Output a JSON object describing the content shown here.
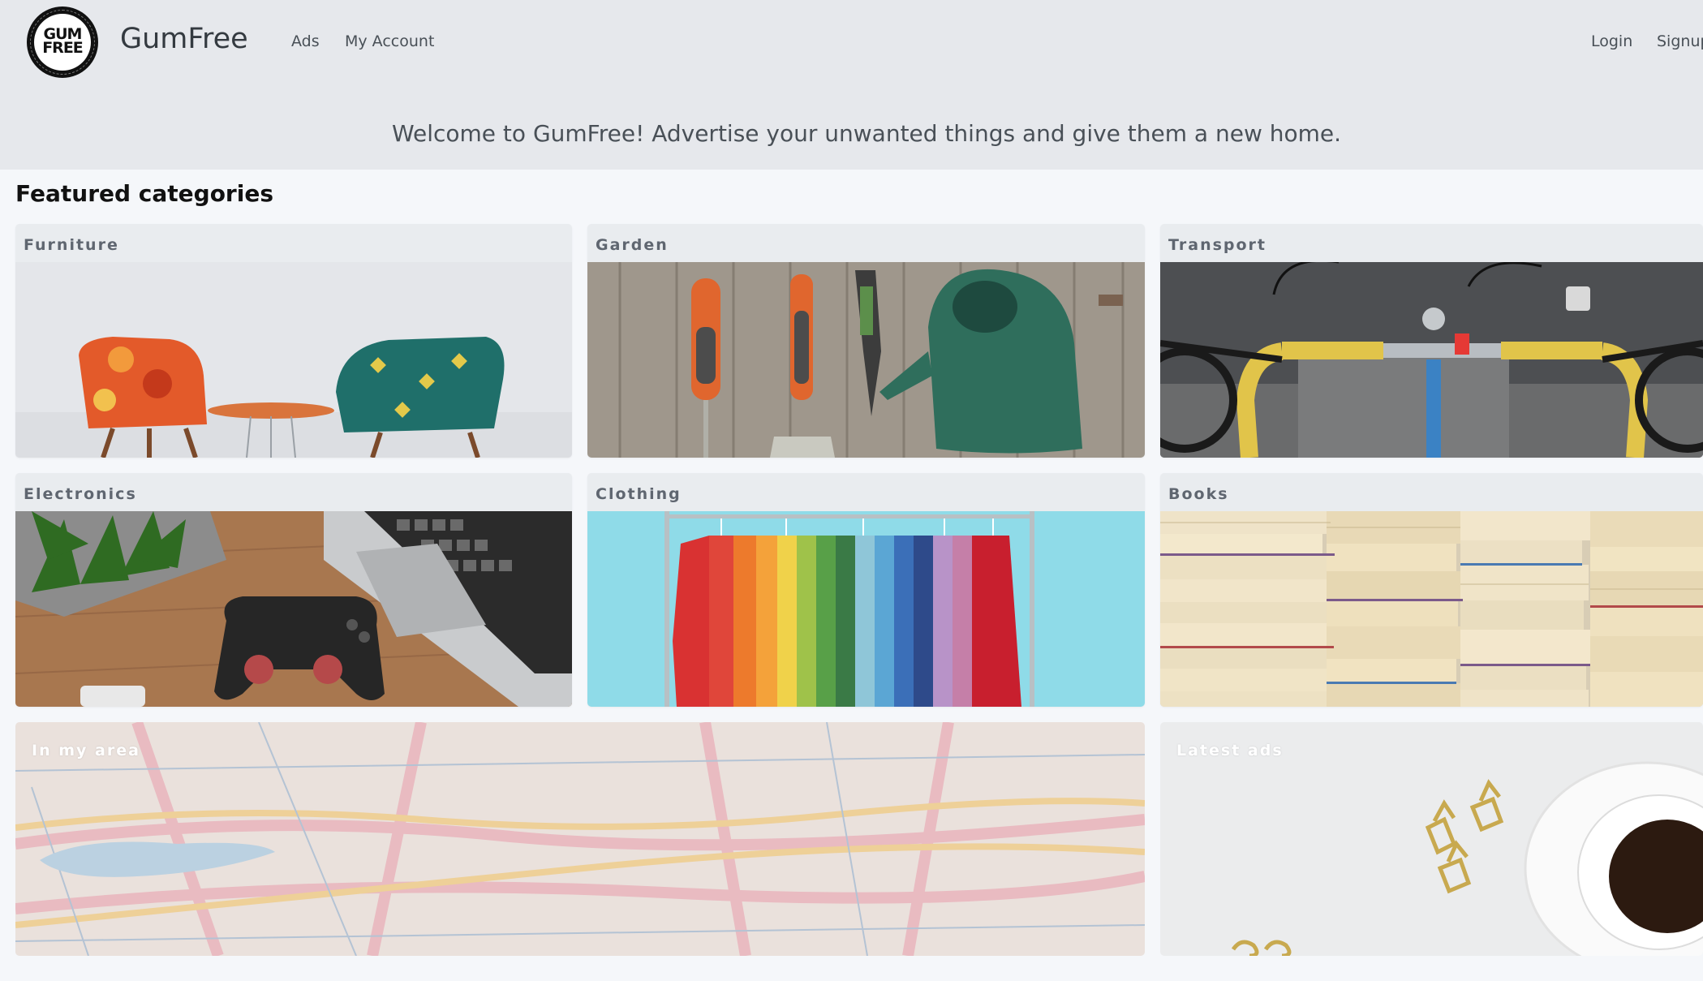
{
  "header": {
    "logo_text_line1": "GUM",
    "logo_text_line2": "FREE",
    "brand": "GumFree",
    "nav": {
      "ads": "Ads",
      "my_account": "My Account",
      "login": "Login",
      "signup": "Signup"
    },
    "welcome": "Welcome to GumFree! Advertise your unwanted things and give them a new home."
  },
  "main": {
    "featured_title": "Featured categories",
    "categories": [
      {
        "label": "Furniture",
        "image": "armchairs-photo"
      },
      {
        "label": "Garden",
        "image": "garden-tools-photo"
      },
      {
        "label": "Transport",
        "image": "bicycle-handlebar-photo"
      },
      {
        "label": "Electronics",
        "image": "gamepad-laptop-photo"
      },
      {
        "label": "Clothing",
        "image": "clothes-rack-photo"
      },
      {
        "label": "Books",
        "image": "book-stack-photo"
      }
    ],
    "wide_cards": [
      {
        "label": "In my area",
        "image": "map-photo"
      },
      {
        "label": "Latest ads",
        "image": "coffee-clips-photo"
      }
    ]
  },
  "colors": {
    "header_bg": "#e6e8ec",
    "page_bg": "#f5f7fa",
    "card_bg": "#e9ecef"
  }
}
